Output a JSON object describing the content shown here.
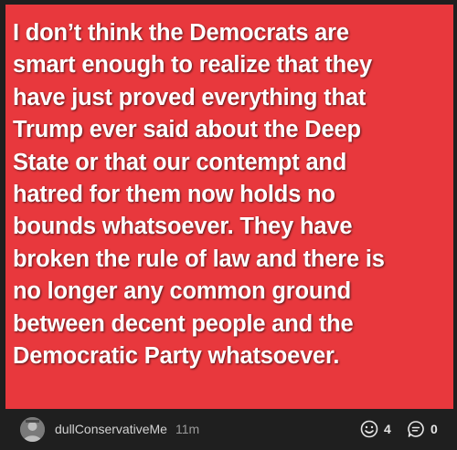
{
  "post": {
    "text": "I don’t think the Democrats are\nsmart enough to realize that they\nhave just proved everything that\nTrump ever said about the Deep\nState or that our contempt and\nhatred for them now holds no\nbounds whatsoever. They have\nbroken the rule of law and there is\nno longer any common ground\nbetween decent people and the\nDemocratic Party whatsoever.",
    "background_color": "#e8383d",
    "text_color": "#ffffff"
  },
  "footer": {
    "username": "dullConservativeMe",
    "time_ago": "11m",
    "avatar_icon": "avatar",
    "reactions_icon": "smiley-face-icon",
    "reactions_count": "4",
    "comments_icon": "comment-bubble-icon",
    "comments_count": "0"
  }
}
